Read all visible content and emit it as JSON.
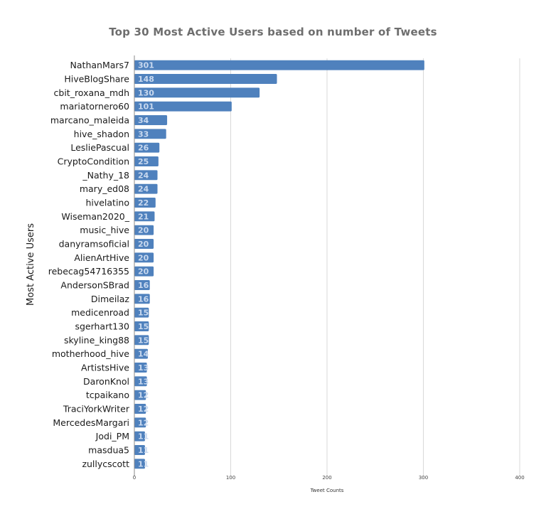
{
  "chart_data": {
    "type": "bar",
    "orientation": "horizontal",
    "title": "Top 30 Most Active Users based on number of Tweets",
    "xlabel": "Tweet Counts",
    "ylabel": "Most Active Users",
    "xlim": [
      0,
      400
    ],
    "xticks": [
      0,
      100,
      200,
      300,
      400
    ],
    "grid": true,
    "legend": "none",
    "bar_color": "#4f81bd",
    "data_label_color": "#c9d9ef",
    "categories": [
      "NathanMars7",
      "HiveBlogShare",
      "cbit_roxana_mdh",
      "mariatornero60",
      "marcano_maleida",
      "hive_shadon",
      "LesliePascual",
      "CryptoCondition",
      "_Nathy_18",
      "mary_ed08",
      "hivelatino",
      "Wiseman2020_",
      "music_hive",
      "danyramsoficial",
      "AlienArtHive",
      "rebecag54716355",
      "AndersonSBrad",
      "Dimeilaz",
      "medicenroad",
      "sgerhart130",
      "skyline_king88",
      "motherhood_hive",
      "ArtistsHive",
      "DaronKnol",
      "tcpaikano",
      "TraciYorkWriter",
      "MercedesMargari",
      "Jodi_PM",
      "masdua5",
      "zullycscott"
    ],
    "values": [
      301,
      148,
      130,
      101,
      34,
      33,
      26,
      25,
      24,
      24,
      22,
      21,
      20,
      20,
      20,
      20,
      16,
      16,
      15,
      15,
      15,
      14,
      13,
      13,
      12,
      12,
      12,
      11,
      11,
      11
    ]
  }
}
